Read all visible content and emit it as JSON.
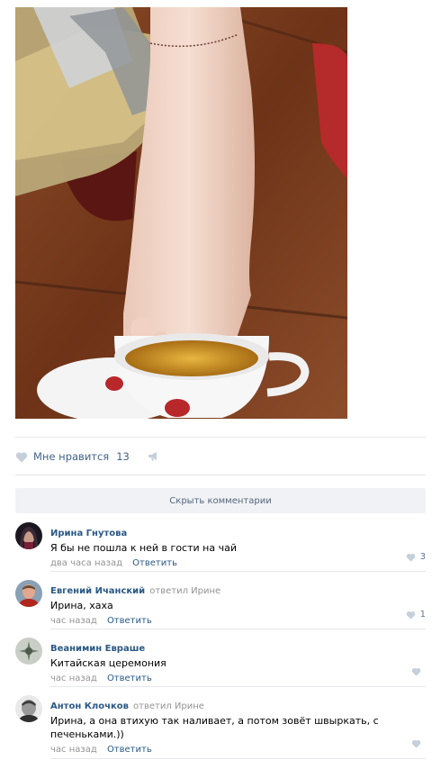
{
  "post": {
    "image_icon": "tea-pouring-photo",
    "likes_label": "Мне нравится",
    "likes_count": "13"
  },
  "comments_toggle": "Скрыть комментарии",
  "comments": [
    {
      "author": "Ирина Гнутова",
      "replied_to": "",
      "text": "Я бы не пошла к ней в гости на чай",
      "time": "два часа назад",
      "reply_label": "Ответить",
      "likes": "3"
    },
    {
      "author": "Евгений Ичанский",
      "replied_to": "ответил Ирине",
      "text": "Ирина, хаха",
      "time": "час назад",
      "reply_label": "Ответить",
      "likes": "1"
    },
    {
      "author": "Веанимин Евраше",
      "replied_to": "",
      "text": "Китайская церемония",
      "time": "час назад",
      "reply_label": "Ответить",
      "likes": ""
    },
    {
      "author": "Антон Клочков",
      "replied_to": "ответил Ирине",
      "text": "Ирина, а она втихую так наливает, а потом зовёт швыркать, с печеньками.))",
      "time": "час назад",
      "reply_label": "Ответить",
      "likes": ""
    }
  ],
  "colors": {
    "link": "#2a5885",
    "muted": "#939393",
    "like": "#5b7595"
  }
}
